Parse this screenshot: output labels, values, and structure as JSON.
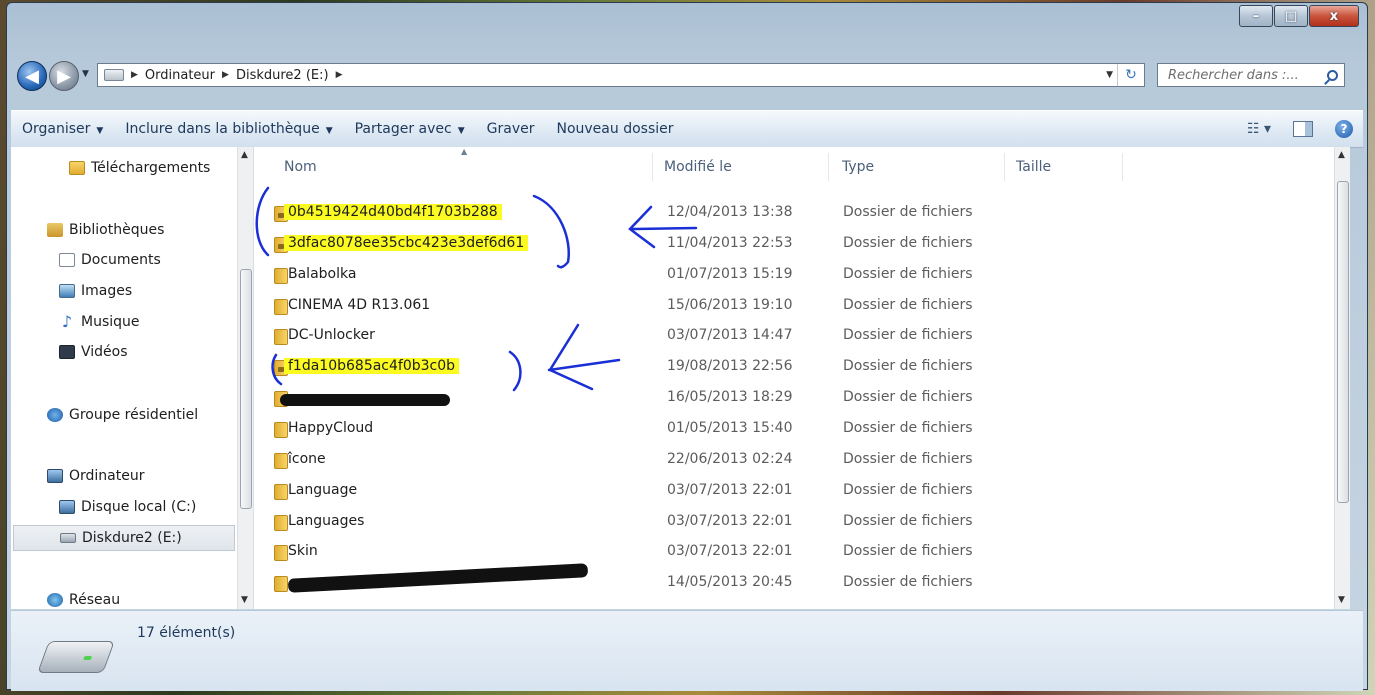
{
  "window": {
    "controls": {
      "minimize": "–",
      "maximize": "□",
      "close": "x"
    }
  },
  "address": {
    "crumbs": [
      "Ordinateur",
      "Diskdure2 (E:)"
    ],
    "search_placeholder": "Rechercher dans :..."
  },
  "toolbar": {
    "organize": "Organiser",
    "include": "Inclure dans la bibliothèque",
    "share": "Partager avec",
    "burn": "Graver",
    "new_folder": "Nouveau dossier"
  },
  "nav": {
    "downloads": "Téléchargements",
    "libraries": "Bibliothèques",
    "documents": "Documents",
    "images": "Images",
    "music": "Musique",
    "videos": "Vidéos",
    "homegroup": "Groupe résidentiel",
    "computer": "Ordinateur",
    "local_disk": "Disque local (C:)",
    "disk2": "Diskdure2 (E:)",
    "network": "Réseau"
  },
  "columns": {
    "name": "Nom",
    "modified": "Modifié le",
    "type": "Type",
    "size": "Taille"
  },
  "files": [
    {
      "name": "0b4519424d40bd4f1703b288",
      "date": "12/04/2013 13:38",
      "type": "Dossier de fichiers"
    },
    {
      "name": "3dfac8078ee35cbc423e3def6d61",
      "date": "11/04/2013 22:53",
      "type": "Dossier de fichiers"
    },
    {
      "name": "Balabolka",
      "date": "01/07/2013 15:19",
      "type": "Dossier de fichiers"
    },
    {
      "name": "CINEMA 4D R13.061",
      "date": "15/06/2013 19:10",
      "type": "Dossier de fichiers"
    },
    {
      "name": "DC-Unlocker",
      "date": "03/07/2013 14:47",
      "type": "Dossier de fichiers"
    },
    {
      "name": "f1da10b685ac4f0b3c0b",
      "date": "19/08/2013 22:56",
      "type": "Dossier de fichiers"
    },
    {
      "name": "",
      "date": "16/05/2013 18:29",
      "type": "Dossier de fichiers"
    },
    {
      "name": "HappyCloud",
      "date": "01/05/2013 15:40",
      "type": "Dossier de fichiers"
    },
    {
      "name": "îcone",
      "date": "22/06/2013 02:24",
      "type": "Dossier de fichiers"
    },
    {
      "name": "Language",
      "date": "03/07/2013 22:01",
      "type": "Dossier de fichiers"
    },
    {
      "name": "Languages",
      "date": "03/07/2013 22:01",
      "type": "Dossier de fichiers"
    },
    {
      "name": "Skin",
      "date": "03/07/2013 22:01",
      "type": "Dossier de fichiers"
    },
    {
      "name": "",
      "date": "14/05/2013 20:45",
      "type": "Dossier de fichiers"
    }
  ],
  "status": {
    "count": "17 élément(s)"
  },
  "colors": {
    "highlight": "#fbfb22",
    "annotation_ink": "#1a2fd6"
  }
}
